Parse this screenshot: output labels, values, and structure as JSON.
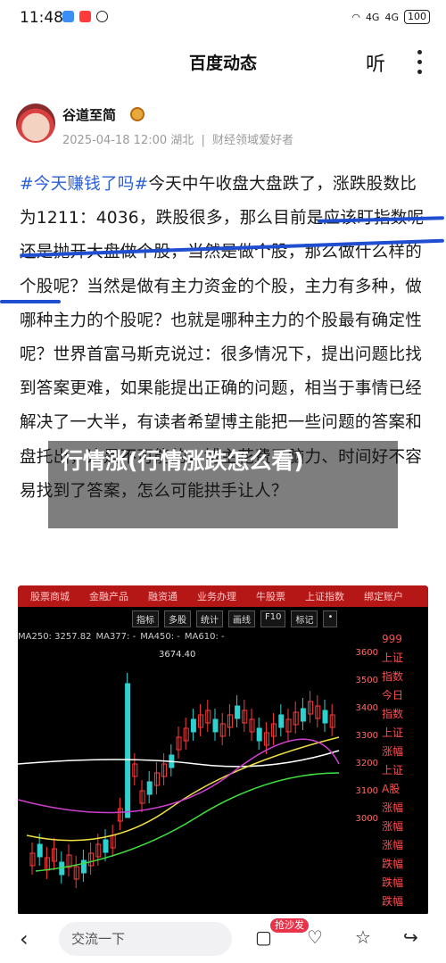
{
  "status": {
    "time": "11:48",
    "signal_1": "4G",
    "signal_2": "4G",
    "battery": "100"
  },
  "header": {
    "title": "百度动态",
    "listen_label": "听"
  },
  "author": {
    "name": "谷道至简",
    "date": "2025-04-18 12:00",
    "location": "湖北",
    "separator": "|",
    "tag": "财经领域爱好者"
  },
  "article": {
    "hashtag": "#今天赚钱了吗#",
    "body": "今天中午收盘大盘跌了，涨跌股数比为1211：4036，跌股很多，那么目前是应该盯指数呢还是抛开大盘做个股，当然是做个股，那么做什么样的个股呢？当然是做有主力资金的个股，主力有多种，做哪种主力的个股呢？也就是哪种主力的个股最有确定性呢？世界首富马斯克说过：很多情况下，提出问题比找到答案更难，如果能提出正确的问题，相当于事情已经解决了一大半，有读者希望博主能把一些问题的答案和盘托出，这是不可能的，博主花费了脑力、时间好不容易找到了答案，怎么可能拱手让人？"
  },
  "overlay_title": "行情涨(行情涨跌怎么看)",
  "chart_image": {
    "topbar": [
      "股票商城",
      "金融产品",
      "融资通",
      "业务办理",
      "牛股票",
      "上证指数",
      "绑定账户"
    ],
    "toolbar": [
      "指标",
      "多股",
      "统计",
      "画线",
      "F10",
      "标记",
      "•"
    ],
    "legend": [
      "MA250: 3257.82",
      "MA377: -",
      "MA450: -",
      "MA610: -"
    ],
    "peak_label": "3674.40",
    "axis": [
      "3600",
      "3500",
      "3400",
      "3300",
      "3200",
      "3100",
      "3000"
    ],
    "side": [
      "999",
      "上证",
      "指数",
      "今日",
      "指数",
      "上证",
      "涨幅",
      "上证",
      "A股",
      "涨幅",
      "涨幅",
      "涨幅",
      "跌幅",
      "跌幅",
      "跌幅"
    ],
    "colors": {
      "up": "#ff3b3b",
      "down": "#2fd0d0",
      "ma1": "#ffffff",
      "ma2": "#f0e040",
      "ma3": "#d040d0",
      "ma4": "#40e040"
    }
  },
  "bottom": {
    "comment_placeholder": "交流一下",
    "sofa_label": "抢沙发"
  }
}
